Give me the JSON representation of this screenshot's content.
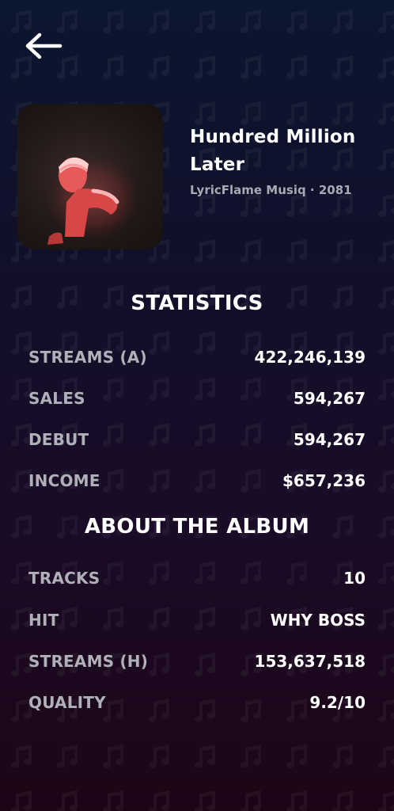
{
  "album": {
    "title": "Hundred Million Later",
    "subtitle": "LyricFlame Musiq · 2081"
  },
  "statistics": {
    "heading": "STATISTICS",
    "rows": [
      {
        "label": "STREAMS (A)",
        "value": "422,246,139"
      },
      {
        "label": "SALES",
        "value": "594,267"
      },
      {
        "label": "DEBUT",
        "value": "594,267"
      },
      {
        "label": "INCOME",
        "value": "$657,236"
      }
    ]
  },
  "about": {
    "heading": "ABOUT THE ALBUM",
    "rows": [
      {
        "label": "TRACKS",
        "value": "10"
      },
      {
        "label": "HIT",
        "value": "WHY BOSS"
      },
      {
        "label": "STREAMS (H)",
        "value": "153,637,518"
      },
      {
        "label": "QUALITY",
        "value": "9.2/10"
      }
    ]
  },
  "colors": {
    "background_top": "#0b1630",
    "background_bottom": "#1c0517",
    "label": "#b0b0b8",
    "value": "#ffffff",
    "subtitle": "#a9a9b4"
  },
  "icons": {
    "back": "arrow-left-icon",
    "background_pattern": "music-note-icon"
  }
}
